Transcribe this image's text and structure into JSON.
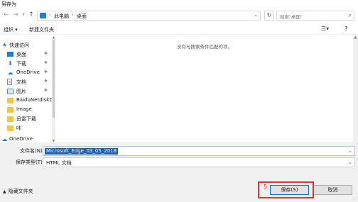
{
  "window": {
    "title": "另存为"
  },
  "nav": {
    "back_icon": "arrow-left-icon",
    "forward_icon": "arrow-right-icon",
    "recent_icon": "chevron-down-icon",
    "up_icon": "arrow-up-icon",
    "breadcrumb": [
      "此电脑",
      "桌面"
    ],
    "separator": "›",
    "search_placeholder": "搜索\"桌面\""
  },
  "toolbar": {
    "organize": "组织 ▾",
    "new_folder": "新建文件夹"
  },
  "sidebar": {
    "items": [
      {
        "label": "快速访问",
        "icon": "star-icon",
        "pinned": false,
        "top": true
      },
      {
        "label": "桌面",
        "icon": "desktop-icon",
        "pinned": true
      },
      {
        "label": "下载",
        "icon": "download-icon",
        "pinned": true
      },
      {
        "label": "OneDrive",
        "icon": "cloud-icon",
        "pinned": true
      },
      {
        "label": "文档",
        "icon": "document-icon",
        "pinned": true
      },
      {
        "label": "图片",
        "icon": "picture-icon",
        "pinned": true
      },
      {
        "label": "BaiduNetdiskD",
        "icon": "folder-icon",
        "pinned": false
      },
      {
        "label": "Image",
        "icon": "folder-icon",
        "pinned": false
      },
      {
        "label": "迅雷下载",
        "icon": "folder-icon",
        "pinned": false
      },
      {
        "label": "咔",
        "icon": "folder-icon",
        "pinned": false
      },
      {
        "label": "OneDrive",
        "icon": "cloud-icon",
        "pinned": false,
        "top": true
      }
    ]
  },
  "content": {
    "empty_message": "没有与搜索条件匹配的项。"
  },
  "form": {
    "filename_label": "文件名(N):",
    "filename_value": "Microsoft_Edge_03_05_2018",
    "filetype_label": "保存类型(T):",
    "filetype_value": "HTML 文档"
  },
  "footer": {
    "hide_folders": "隐藏文件夹",
    "save_label": "保存(S)",
    "cancel_label": "取消",
    "annotation_number": "5"
  },
  "colors": {
    "accent": "#0078d7",
    "highlight": "#e8302a",
    "folder": "#f4c542"
  }
}
